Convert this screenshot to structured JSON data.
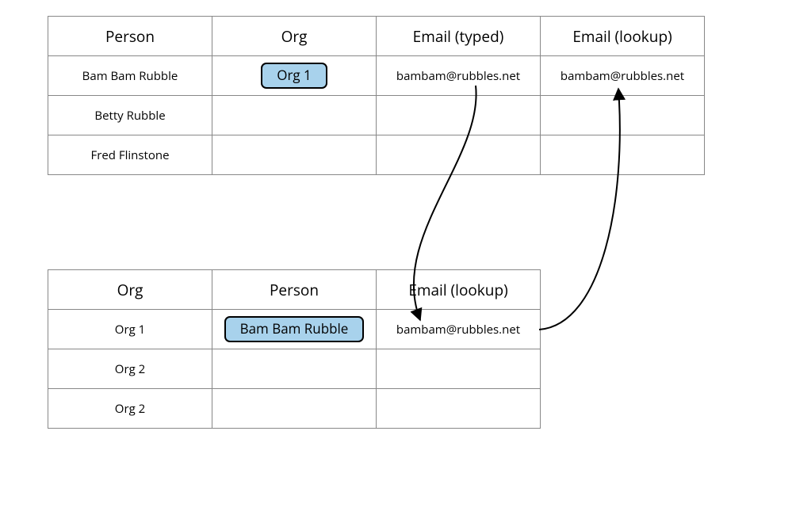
{
  "top_table": {
    "headers": [
      "Person",
      "Org",
      "Email (typed)",
      "Email (lookup)"
    ],
    "rows": [
      {
        "person": "Bam Bam Rubble",
        "org_chip": "Org 1",
        "email_typed": "bambam@rubbles.net",
        "email_lookup": "bambam@rubbles.net"
      },
      {
        "person": "Betty Rubble",
        "org_chip": "",
        "email_typed": "",
        "email_lookup": ""
      },
      {
        "person": "Fred Flinstone",
        "org_chip": "",
        "email_typed": "",
        "email_lookup": ""
      }
    ]
  },
  "bottom_table": {
    "headers": [
      "Org",
      "Person",
      "Email (lookup)"
    ],
    "rows": [
      {
        "org": "Org 1",
        "person_chip": "Bam Bam Rubble",
        "email_lookup": "bambam@rubbles.net"
      },
      {
        "org": "Org 2",
        "person_chip": "",
        "email_lookup": ""
      },
      {
        "org": "Org 2",
        "person_chip": "",
        "email_lookup": ""
      }
    ]
  },
  "colors": {
    "chip_fill": "#a8d2ec",
    "chip_border": "#000000",
    "table_border": "#888888"
  }
}
